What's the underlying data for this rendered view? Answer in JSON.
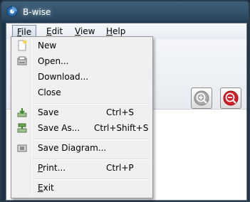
{
  "window": {
    "title": "B-wise"
  },
  "menubar": {
    "items": [
      {
        "pre": "",
        "key": "F",
        "post": "ile"
      },
      {
        "pre": "",
        "key": "E",
        "post": "dit"
      },
      {
        "pre": "",
        "key": "V",
        "post": "iew"
      },
      {
        "pre": "",
        "key": "H",
        "post": "elp"
      }
    ]
  },
  "file_menu": {
    "items": [
      {
        "pre": "",
        "key": "",
        "post": "New",
        "shortcut": "",
        "icon": "new-document-icon"
      },
      {
        "pre": "",
        "key": "",
        "post": "Open...",
        "shortcut": "",
        "icon": "open-icon"
      },
      {
        "pre": "",
        "key": "",
        "post": "Download...",
        "shortcut": "",
        "icon": ""
      },
      {
        "pre": "",
        "key": "",
        "post": "Close",
        "shortcut": "",
        "icon": ""
      },
      {
        "pre": "",
        "key": "",
        "post": "Save",
        "shortcut": "Ctrl+S",
        "icon": "save-icon"
      },
      {
        "pre": "",
        "key": "",
        "post": "Save As...",
        "shortcut": "Ctrl+Shift+S",
        "icon": "save-as-icon"
      },
      {
        "pre": "",
        "key": "",
        "post": "Save Diagram...",
        "shortcut": "",
        "icon": "save-diagram-icon"
      },
      {
        "pre": "",
        "key": "P",
        "post": "rint...",
        "shortcut": "Ctrl+P",
        "icon": ""
      },
      {
        "pre": "",
        "key": "E",
        "post": "xit",
        "shortcut": "",
        "icon": ""
      }
    ]
  },
  "toolbar": {
    "zoom_in_icon": "zoom-in-icon",
    "zoom_out_icon": "zoom-out-icon"
  },
  "colors": {
    "titlebar": "#2b4a62",
    "zoom_out_accent": "#d21f27",
    "zoom_in_accent": "#9a9a9a"
  }
}
